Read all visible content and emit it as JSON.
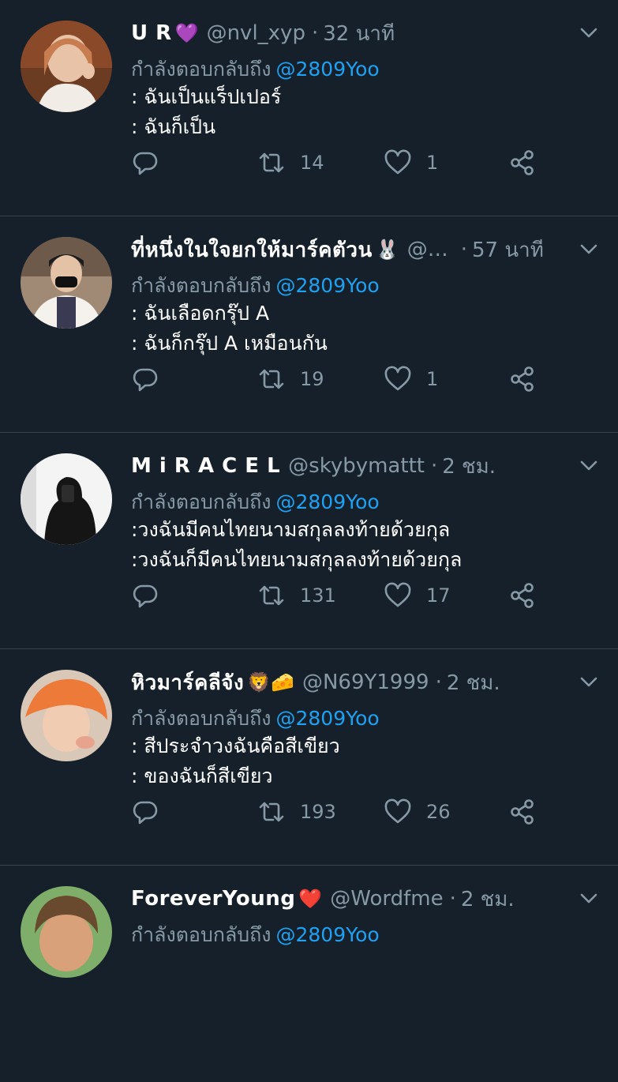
{
  "tweets": [
    {
      "name": "U R",
      "emoji": "💜",
      "handle": "@nvl_xyp",
      "time": "32 นาที",
      "reply_prefix": "กำลังตอบกลับถึง",
      "reply_to": "@2809Yoo",
      "line1": ": ฉันเป็นแร็ปเปอร์",
      "line2": ": ฉันก็เป็น",
      "retweets": "14",
      "likes": "1"
    },
    {
      "name": "ที่หนึ่งในใจยกให้มาร์คตัวน",
      "emoji": "🐰",
      "handle": "@S...",
      "time": "57 นาที",
      "reply_prefix": "กำลังตอบกลับถึง",
      "reply_to": "@2809Yoo",
      "line1": ": ฉันเลือดกรุ๊ป A",
      "line2": ": ฉันก็กรุ๊ป A เหมือนกัน",
      "retweets": "19",
      "likes": "1"
    },
    {
      "name": "M i R A C E L",
      "emoji": "",
      "handle": "@skybymattt",
      "time": "2 ชม.",
      "reply_prefix": "กำลังตอบกลับถึง",
      "reply_to": "@2809Yoo",
      "line1": ":วงฉันมีคนไทยนามสกุลลงท้ายด้วยกุล",
      "line2": ":วงฉันก็มีคนไทยนามสกุลลงท้ายด้วยกุล",
      "retweets": "131",
      "likes": "17"
    },
    {
      "name": "หิวมาร์คลีจัง",
      "emoji": "🦁🧀",
      "handle": "@N69Y1999",
      "time": "2 ชม.",
      "reply_prefix": "กำลังตอบกลับถึง",
      "reply_to": "@2809Yoo",
      "line1": ": สีประจำวงฉันคือสีเขียว",
      "line2": ": ของฉันก็สีเขียว",
      "retweets": "193",
      "likes": "26"
    },
    {
      "name": "ForeverYoung",
      "emoji": "❤️",
      "handle": "@Wordfme",
      "time": "2 ชม.",
      "reply_prefix": "กำลังตอบกลับถึง",
      "reply_to": "@2809Yoo",
      "line1": "",
      "line2": "",
      "retweets": "",
      "likes": ""
    }
  ],
  "colors": {
    "background": "#15202b",
    "divider": "#38444d",
    "secondary_text": "#8899a6",
    "link": "#1da1f2"
  },
  "icons": [
    "reply-icon",
    "retweet-icon",
    "like-icon",
    "share-icon",
    "chevron-down-icon"
  ]
}
